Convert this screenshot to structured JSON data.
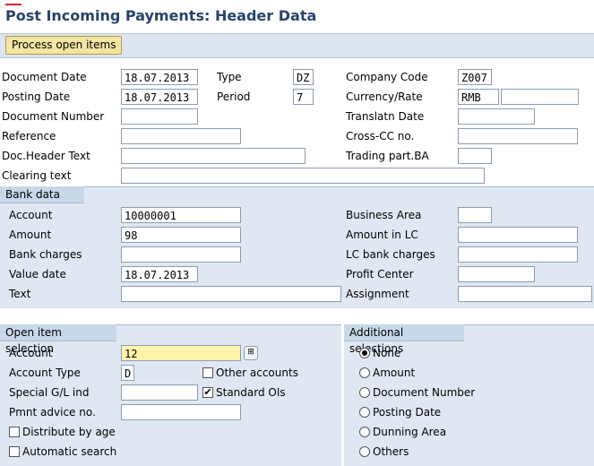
{
  "page": {
    "title": "Post Incoming Payments: Header Data"
  },
  "toolbar": {
    "process_open_items": "Process open items"
  },
  "header": {
    "document_date_label": "Document Date",
    "document_date": "18.07.2013",
    "type_label": "Type",
    "type": "DZ",
    "company_code_label": "Company Code",
    "company_code": "Z007",
    "posting_date_label": "Posting Date",
    "posting_date": "18.07.2013",
    "period_label": "Period",
    "period": "7",
    "currency_rate_label": "Currency/Rate",
    "currency": "RMB",
    "rate": "",
    "document_number_label": "Document Number",
    "document_number": "",
    "translatn_date_label": "Translatn Date",
    "translatn_date": "",
    "reference_label": "Reference",
    "reference": "",
    "cross_cc_label": "Cross-CC no.",
    "cross_cc": "",
    "doc_header_text_label": "Doc.Header Text",
    "doc_header_text": "",
    "trading_part_label": "Trading part.BA",
    "trading_part": "",
    "clearing_text_label": "Clearing text",
    "clearing_text": ""
  },
  "bank_data": {
    "title": "Bank data",
    "account_label": "Account",
    "account": "10000001",
    "business_area_label": "Business Area",
    "business_area": "",
    "amount_label": "Amount",
    "amount": "98",
    "amount_lc_label": "Amount in LC",
    "amount_lc": "",
    "bank_charges_label": "Bank charges",
    "bank_charges": "",
    "lc_bank_charges_label": "LC bank charges",
    "lc_bank_charges": "",
    "value_date_label": "Value date",
    "value_date": "18.07.2013",
    "profit_center_label": "Profit Center",
    "profit_center": "",
    "text_label": "Text",
    "text": "",
    "assignment_label": "Assignment",
    "assignment": ""
  },
  "open_item_selection": {
    "title": "Open item selection",
    "account_label": "Account",
    "account": "12",
    "account_type_label": "Account Type",
    "account_type": "D",
    "other_accounts_label": "Other accounts",
    "other_accounts_checked": false,
    "special_gl_label": "Special G/L ind",
    "special_gl": "",
    "standard_ois_label": "Standard OIs",
    "standard_ois_checked": true,
    "pmnt_advice_label": "Pmnt advice no.",
    "pmnt_advice": "",
    "distribute_by_age_label": "Distribute by age",
    "distribute_by_age_checked": false,
    "automatic_search_label": "Automatic search",
    "automatic_search_checked": false
  },
  "additional_selections": {
    "title": "Additional selections",
    "options": [
      "None",
      "Amount",
      "Document Number",
      "Posting Date",
      "Dunning Area",
      "Others"
    ],
    "selected": "None"
  }
}
